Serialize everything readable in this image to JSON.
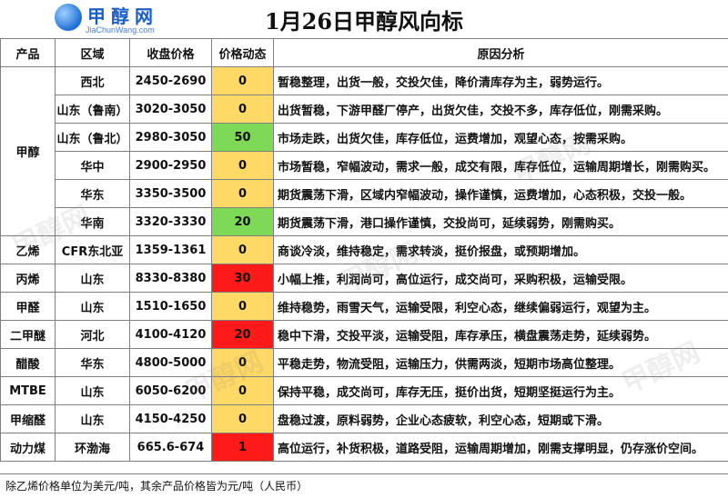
{
  "logo": {
    "text": "甲醇网",
    "url": "JiaChunWang.com"
  },
  "title": "1月26日甲醇风向标",
  "columns": [
    "产品",
    "区域",
    "收盘价格",
    "价格动态",
    "原因分析"
  ],
  "rows": [
    {
      "product": "甲醇",
      "region": "西北",
      "price": "2450-2690",
      "change": "0",
      "change_color": "#ffd966",
      "analysis": "暂稳整理，出货一般，交投欠佳，降价清库存为主，弱势运行。"
    },
    {
      "product": "",
      "region": "山东（鲁南）",
      "price": "3020-3050",
      "change": "0",
      "change_color": "#ffd966",
      "analysis": "出货暂稳，下游甲醛厂停产，出货欠佳，交投不多，库存低位，刚需采购。"
    },
    {
      "product": "",
      "region": "山东（鲁北）",
      "price": "2980-3050",
      "change": "50",
      "change_color": "#7ed957",
      "analysis": "市场走跌，出货欠佳，库存低位，运费增加，观望心态，按需采购。"
    },
    {
      "product": "",
      "region": "华中",
      "price": "2900-2950",
      "change": "0",
      "change_color": "#ffd966",
      "analysis": "市场暂稳，窄幅波动，需求一般，成交有限，库存低位，运输周期增长，刚需购买。"
    },
    {
      "product": "",
      "region": "华东",
      "price": "3350-3500",
      "change": "0",
      "change_color": "#ffd966",
      "analysis": "期货震荡下滑，区域内窄幅波动，操作谨慎，运费增加，心态积极，交投一般。"
    },
    {
      "product": "",
      "region": "华南",
      "price": "3320-3330",
      "change": "20",
      "change_color": "#7ed957",
      "analysis": "期货震荡下滑，港口操作谨慎，交投尚可，延续弱势，刚需购买。"
    },
    {
      "product": "乙烯",
      "region": "CFR东北亚",
      "price": "1359-1361",
      "change": "0",
      "change_color": "#ffd966",
      "analysis": "商谈冷淡，维持稳定，需求转淡，挺价报盘，或预期增加。"
    },
    {
      "product": "丙烯",
      "region": "山东",
      "price": "8330-8380",
      "change": "30",
      "change_color": "#ff1a1a",
      "analysis": "小幅上推，利润尚可，高位运行，成交尚可，采购积极，运输受限。"
    },
    {
      "product": "甲醛",
      "region": "山东",
      "price": "1510-1650",
      "change": "0",
      "change_color": "#ffd966",
      "analysis": "维持稳势，雨雪天气，运输受限，利空心态，继续偏弱运行，观望为主。"
    },
    {
      "product": "二甲醚",
      "region": "河北",
      "price": "4100-4120",
      "change": "20",
      "change_color": "#ff1a1a",
      "analysis": "稳中下滑，交投平淡，运输受阻，库存承压，横盘震荡走势，延续弱势。"
    },
    {
      "product": "醋酸",
      "region": "华东",
      "price": "4800-5000",
      "change": "0",
      "change_color": "#ffd966",
      "analysis": "平稳走势，物流受阻，运输压力，供需两淡，短期市场高位整理。"
    },
    {
      "product": "MTBE",
      "region": "山东",
      "price": "6050-6200",
      "change": "0",
      "change_color": "#ffd966",
      "analysis": "保持平稳，成交尚可，库存无压，挺价出货，短期坚挺运行为主。"
    },
    {
      "product": "甲缩醛",
      "region": "山东",
      "price": "4150-4250",
      "change": "0",
      "change_color": "#ffd966",
      "analysis": "盘稳过渡，原料弱势，企业心态疲软，利空心态，短期或下滑。"
    },
    {
      "product": "动力煤",
      "region": "环渤海",
      "price": "665.6-674",
      "change": "1",
      "change_color": "#ff1a1a",
      "analysis": "高位运行，补货积极，道路受阻，运输周期增加，刚需支撑明显，仍存涨价空间。"
    }
  ],
  "footer": "除乙烯价格单位为美元/吨，其余产品价格皆为元/吨（人民币）",
  "watermark": "甲醇网"
}
